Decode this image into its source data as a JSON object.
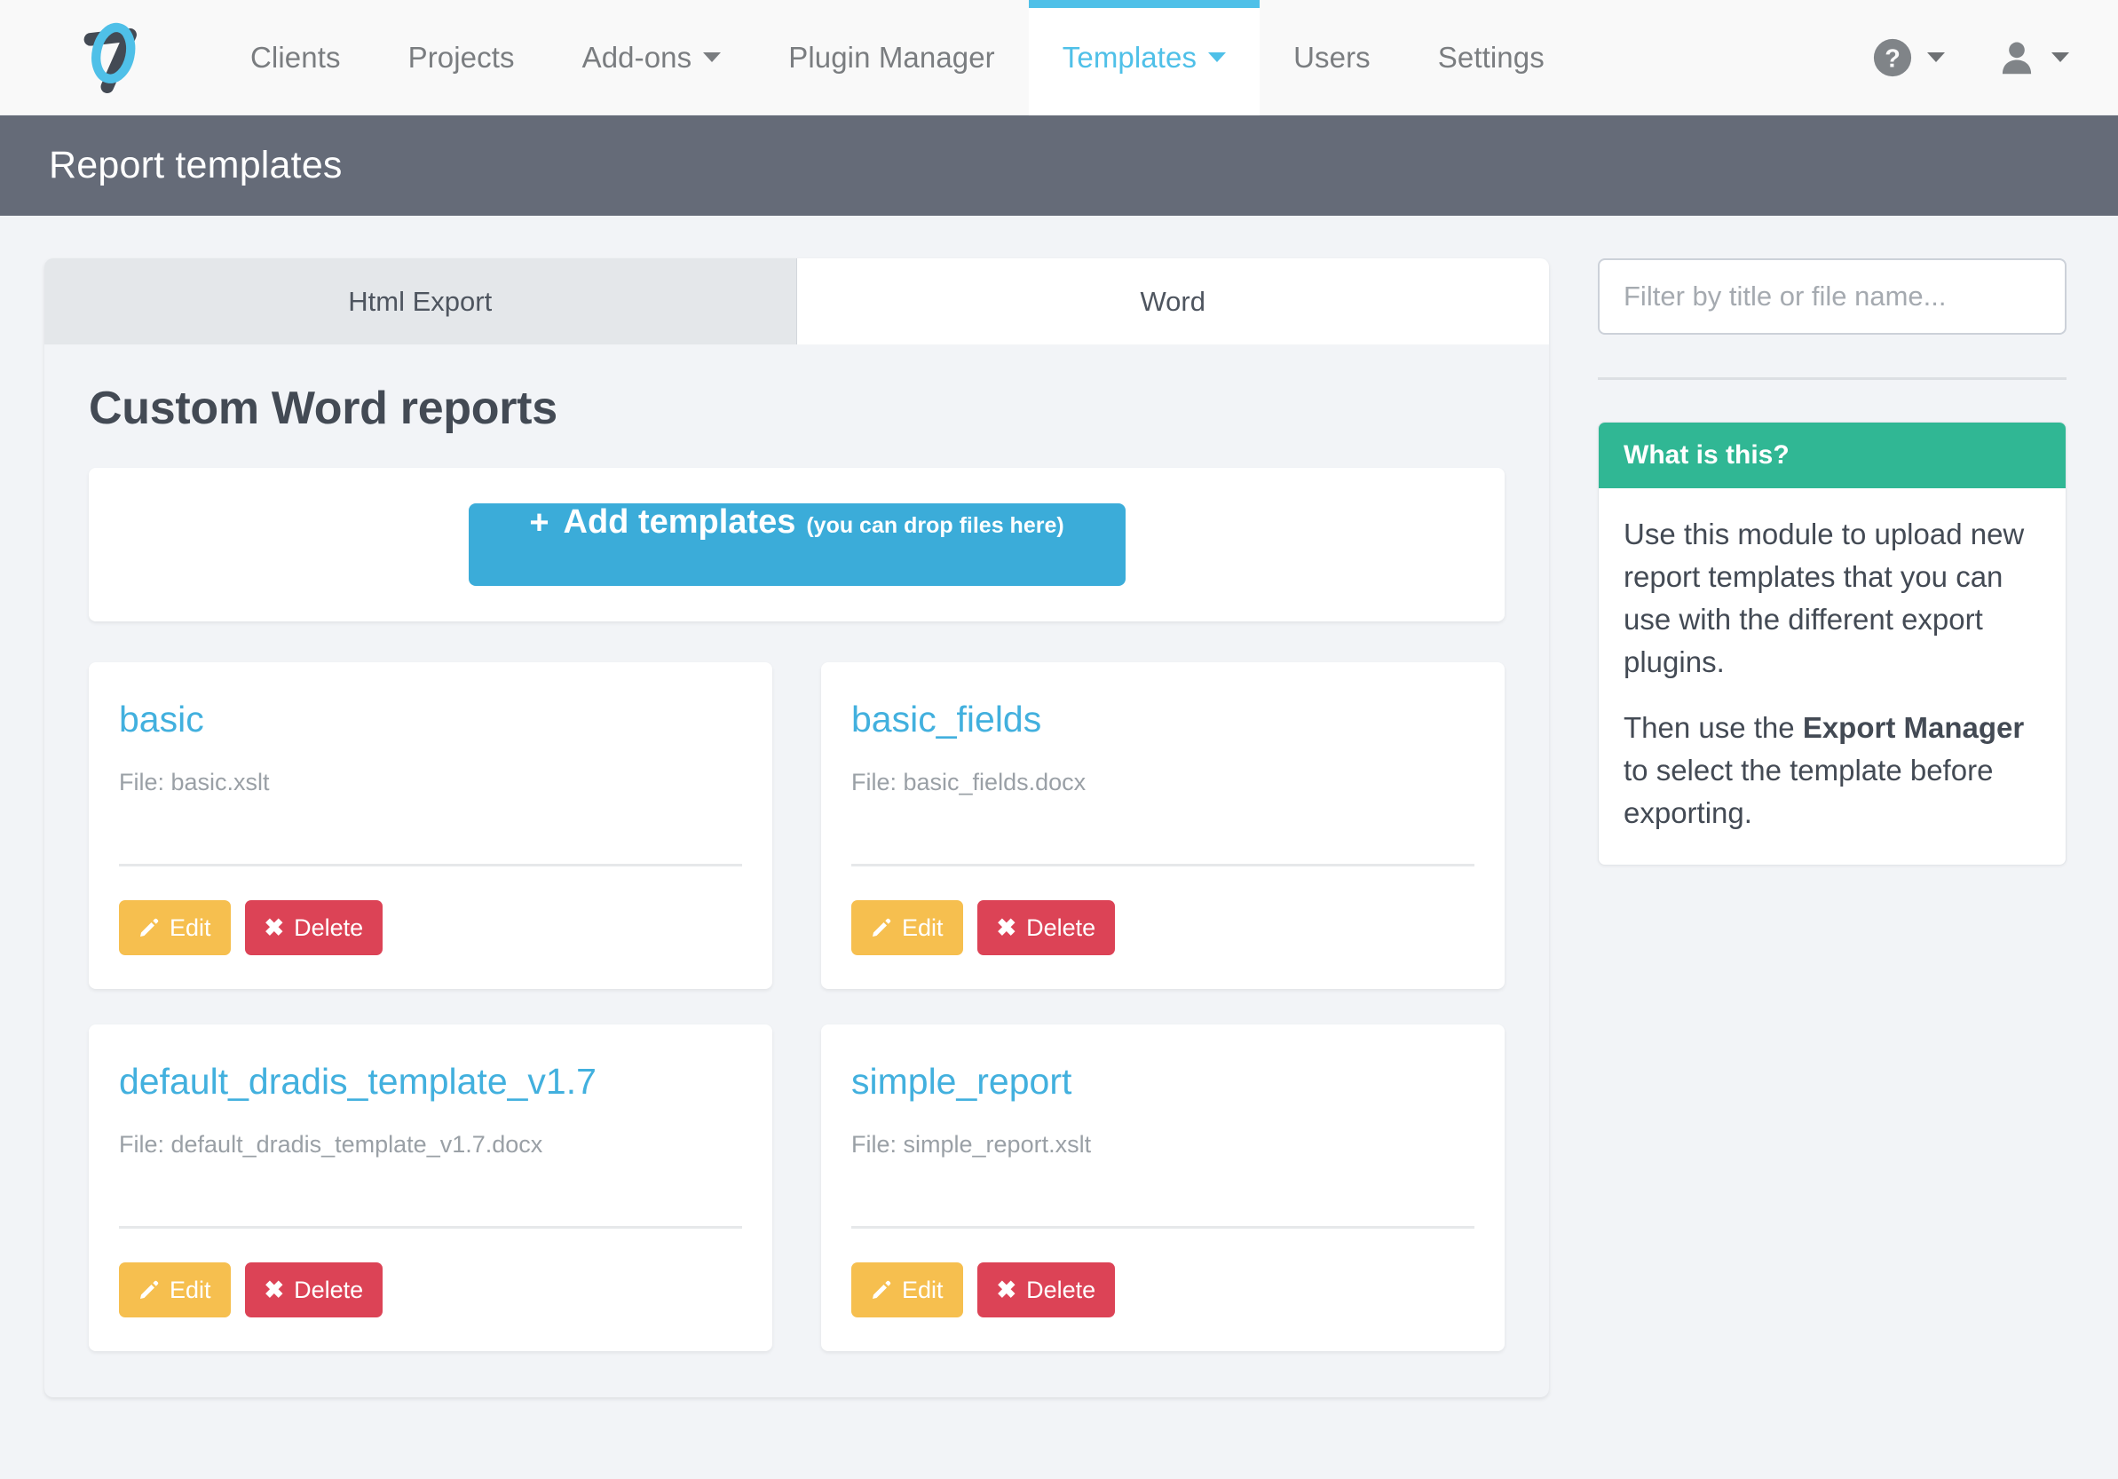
{
  "navbar": {
    "logo_alt": "dradis-logo",
    "items": [
      {
        "label": "Clients",
        "has_caret": false,
        "active": false
      },
      {
        "label": "Projects",
        "has_caret": false,
        "active": false
      },
      {
        "label": "Add-ons",
        "has_caret": true,
        "active": false
      },
      {
        "label": "Plugin Manager",
        "has_caret": false,
        "active": false
      },
      {
        "label": "Templates",
        "has_caret": true,
        "active": true
      },
      {
        "label": "Users",
        "has_caret": false,
        "active": false
      },
      {
        "label": "Settings",
        "has_caret": false,
        "active": false
      }
    ],
    "help_icon": "question-circle-icon",
    "user_icon": "user-icon",
    "accent_color": "#4fc0e8"
  },
  "page_header": {
    "title": "Report templates",
    "background_color": "#656b78"
  },
  "tabs": [
    {
      "label": "Html Export",
      "active": false
    },
    {
      "label": "Word",
      "active": true
    }
  ],
  "main": {
    "section_title": "Custom Word reports",
    "add_button": {
      "plus": "+",
      "label": "Add templates",
      "hint": "(you can drop files here)",
      "color": "#3bacd9"
    },
    "templates": [
      {
        "title": "basic",
        "file_label": "File: basic.xslt",
        "edit_label": "Edit",
        "delete_label": "Delete"
      },
      {
        "title": "basic_fields",
        "file_label": "File: basic_fields.docx",
        "edit_label": "Edit",
        "delete_label": "Delete"
      },
      {
        "title": "default_dradis_template_v1.7",
        "file_label": "File: default_dradis_template_v1.7.docx",
        "edit_label": "Edit",
        "delete_label": "Delete"
      },
      {
        "title": "simple_report",
        "file_label": "File: simple_report.xslt",
        "edit_label": "Edit",
        "delete_label": "Delete"
      }
    ],
    "edit_color": "#f6bf4f",
    "delete_color": "#dc4356",
    "link_color": "#42b0de"
  },
  "sidebar": {
    "filter_placeholder": "Filter by title or file name...",
    "filter_value": "",
    "info_panel": {
      "heading": "What is this?",
      "heading_color": "#30b794",
      "paragraph_1": "Use this module to upload new report templates that you can use with the different export plugins.",
      "paragraph_2_pre": "Then use the ",
      "paragraph_2_bold": "Export Manager",
      "paragraph_2_post": " to select the template before exporting."
    }
  }
}
